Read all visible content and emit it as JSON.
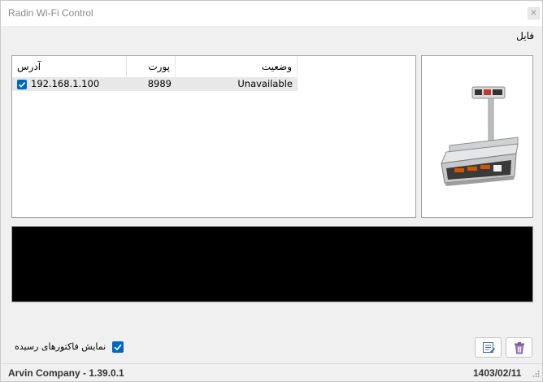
{
  "window": {
    "title": "Radin Wi-Fi Control",
    "close_icon": "close-icon"
  },
  "menu": {
    "file": "فایل"
  },
  "table": {
    "columns": {
      "address": "آدرس",
      "port": "پورت",
      "status": "وضعیت"
    },
    "rows": [
      {
        "checked": true,
        "address": "192.168.1.100",
        "port": "8989",
        "status": "Unavailable"
      }
    ]
  },
  "device_image": {
    "icon": "price-scale-image"
  },
  "options": {
    "show_received_invoices": "نمایش فاکتورهای رسیده",
    "show_received_invoices_checked": true
  },
  "toolbar": {
    "left_button_icon": "invoice-icon",
    "right_button_icon": "trash-icon"
  },
  "statusbar": {
    "company": "Arvin Company - 1.39.0.1",
    "date": "1403/02/11"
  },
  "colors": {
    "accent": "#0067c0",
    "log_background": "#000000"
  }
}
